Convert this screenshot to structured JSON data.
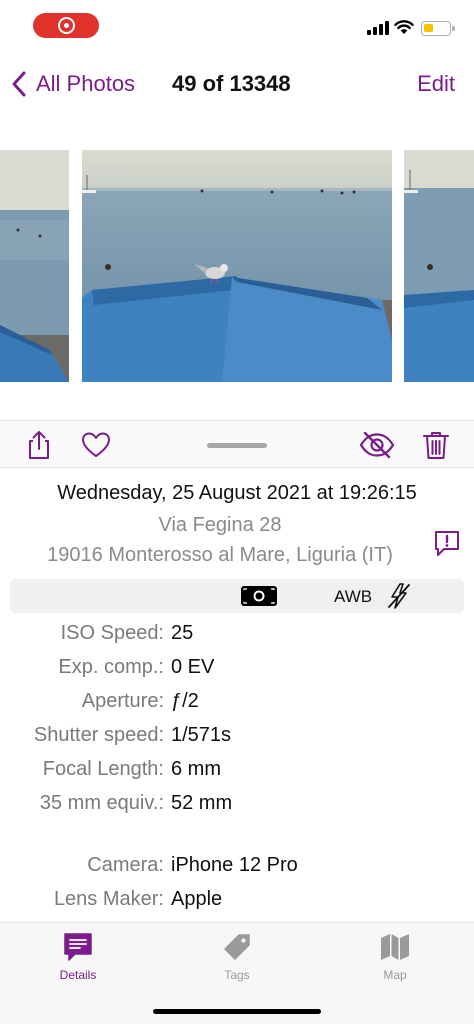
{
  "status_bar": {
    "recording_color": "#e0322b",
    "battery_color": "#f5c400",
    "icons": [
      "record-icon",
      "cellular-signal-icon",
      "wifi-icon",
      "battery-icon"
    ]
  },
  "nav": {
    "back_label": "All Photos",
    "counter": "49 of 13348",
    "edit_label": "Edit",
    "accent_color": "#7a1d8a"
  },
  "toolbar": {
    "icons": [
      "share-icon",
      "heart-icon",
      "hide-icon",
      "trash-icon"
    ]
  },
  "details": {
    "date": "Wednesday, 25 August 2021 at 19:26:15",
    "address_line1": "Via Fegina 28",
    "address_line2": "19016 Monterosso al Mare, Liguria (IT)",
    "awb": "AWB",
    "specs": [
      {
        "label": "ISO Speed:",
        "value": "25"
      },
      {
        "label": "Exp. comp.:",
        "value": "0 EV"
      },
      {
        "label": "Aperture:",
        "value": "ƒ/2"
      },
      {
        "label": "Shutter speed:",
        "value": "1/571s"
      },
      {
        "label": "Focal Length:",
        "value": "6 mm"
      },
      {
        "label": "35 mm equiv.:",
        "value": "52 mm"
      },
      {
        "label": "Camera:",
        "value": "iPhone 12 Pro"
      },
      {
        "label": "Lens Maker:",
        "value": "Apple"
      }
    ]
  },
  "tab_bar": {
    "tabs": [
      {
        "label": "Details",
        "icon": "details-icon",
        "active": true
      },
      {
        "label": "Tags",
        "icon": "tag-icon",
        "active": false
      },
      {
        "label": "Map",
        "icon": "map-icon",
        "active": false
      }
    ],
    "active_color": "#7a1d8a",
    "inactive_color": "#9a9a9a"
  }
}
